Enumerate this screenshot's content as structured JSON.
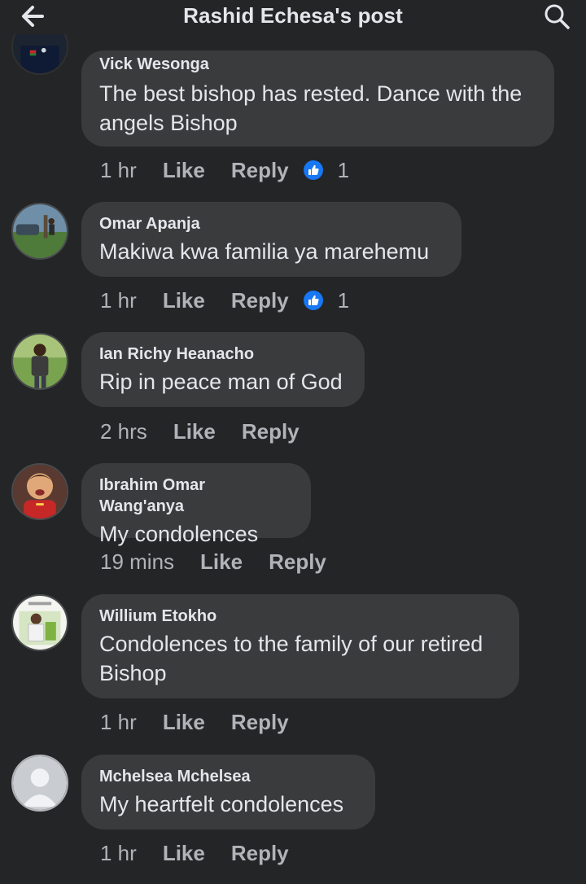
{
  "header": {
    "title": "Rashid Echesa's post"
  },
  "comments": [
    {
      "author": "Vick Wesonga",
      "text_lines": [
        "The best bishop has rested. Dance with the",
        "angels Bishop"
      ],
      "time": "1 hr",
      "like_label": "Like",
      "reply_label": "Reply",
      "reaction_count": "1"
    },
    {
      "author": "Omar Apanja",
      "text_lines": [
        "Makiwa kwa familia ya marehemu"
      ],
      "time": "1 hr",
      "like_label": "Like",
      "reply_label": "Reply",
      "reaction_count": "1"
    },
    {
      "author": "Ian Richy Heanacho",
      "text_lines": [
        "Rip in peace man of God"
      ],
      "time": "2 hrs",
      "like_label": "Like",
      "reply_label": "Reply"
    },
    {
      "author": "Ibrahim Omar Wang'anya",
      "text_lines": [
        "My condolences"
      ],
      "time": "19 mins",
      "like_label": "Like",
      "reply_label": "Reply"
    },
    {
      "author": "Willium Etokho",
      "text_lines": [
        "Condolences to the family of our retired",
        "Bishop"
      ],
      "time": "1 hr",
      "like_label": "Like",
      "reply_label": "Reply"
    },
    {
      "author": "Mchelsea Mchelsea",
      "text_lines": [
        "My heartfelt condolences"
      ],
      "time": "1 hr",
      "like_label": "Like",
      "reply_label": "Reply"
    }
  ],
  "icons": {
    "back": "arrow-left-icon",
    "search": "search-icon",
    "reaction": "like-reaction-icon"
  },
  "colors": {
    "background": "#242526",
    "bubble": "#3a3b3c",
    "primary_text": "#e4e6eb",
    "secondary_text": "#b0b3b8",
    "like_blue": "#1877f2"
  }
}
